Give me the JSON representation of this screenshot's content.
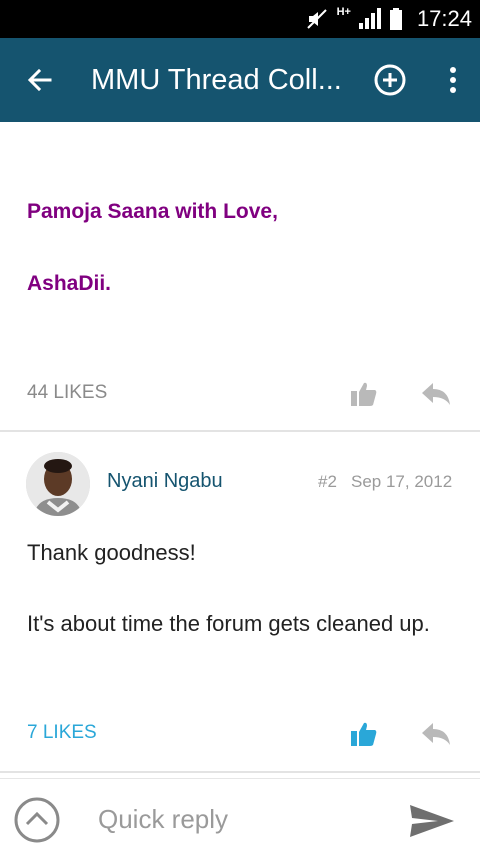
{
  "status_bar": {
    "time": "17:24",
    "network_label": "H+"
  },
  "app_bar": {
    "title": "MMU Thread Coll...",
    "back_icon": "arrow-left-icon",
    "add_icon": "add-circle-icon",
    "more_icon": "more-vert-icon",
    "color": "#15546f"
  },
  "post1": {
    "signature_line1": "Pamoja Saana with Love,",
    "signature_line2": "AshaDii.",
    "signature_color": "#800080",
    "likes": "44 LIKES",
    "liked": false
  },
  "post2": {
    "author": "Nyani Ngabu",
    "number": "#2",
    "date": "Sep 17, 2012",
    "text_line1": "Thank goodness!",
    "text_line2": "It's about time the forum gets cleaned up.",
    "likes": "7 LIKES",
    "liked": true,
    "like_color": "#2aa7d8"
  },
  "quick_reply": {
    "placeholder": "Quick reply",
    "value": ""
  }
}
